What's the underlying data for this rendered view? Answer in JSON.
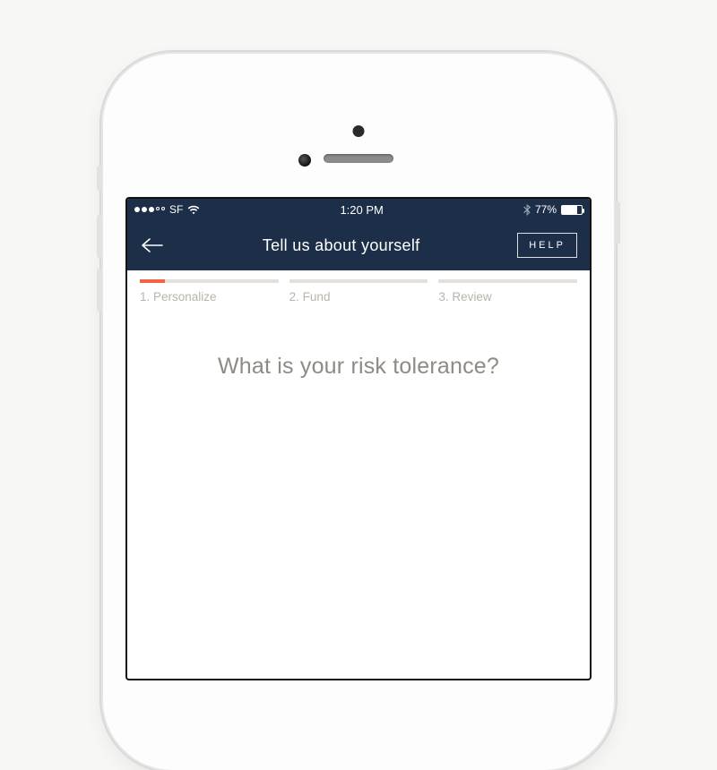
{
  "statusbar": {
    "carrier": "SF",
    "time": "1:20 PM",
    "battery_pct": "77%",
    "battery_fill_pct": 77
  },
  "nav": {
    "title": "Tell us about yourself",
    "help_label": "HELP"
  },
  "steps": [
    {
      "label": "1. Personalize",
      "fill_pct": 18
    },
    {
      "label": "2. Fund",
      "fill_pct": 0
    },
    {
      "label": "3. Review",
      "fill_pct": 0
    }
  ],
  "question": "What is your risk tolerance?",
  "colors": {
    "header_bg": "#1d2e48",
    "accent": "#f2634a",
    "track": "#e5e0da",
    "muted_text": "#b9b3ab"
  }
}
